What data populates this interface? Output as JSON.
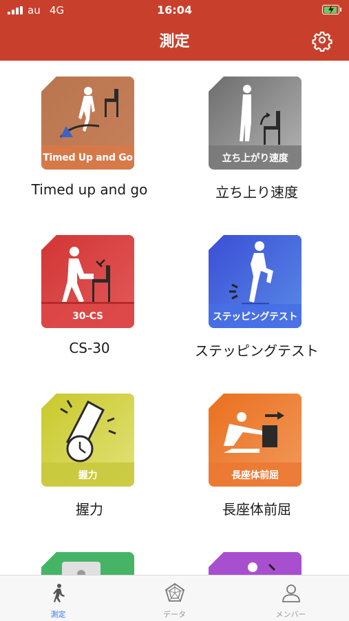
{
  "status_bar": {
    "carrier": "au",
    "network": "4G",
    "time": "16:04"
  },
  "header": {
    "title": "測定",
    "settings_icon": "gear-icon"
  },
  "tests": [
    {
      "label": "Timed up and go",
      "badge": "Timed Up and Go",
      "color": "#b0623a"
    },
    {
      "label": "立ち上り速度",
      "badge": "立ち上がり速度",
      "color": "#7d7d7d"
    },
    {
      "label": "CS-30",
      "badge": "30-CS",
      "color": "#d63c3c"
    },
    {
      "label": "ステッピングテスト",
      "badge": "ステッピングテスト",
      "color": "#3d55d9"
    },
    {
      "label": "握力",
      "badge": "握力",
      "color": "#c4c430"
    },
    {
      "label": "長座体前屈",
      "badge": "長座体前屈",
      "color": "#e8782a"
    },
    {
      "label": "",
      "badge": "",
      "color": "#45b565"
    },
    {
      "label": "",
      "badge": "",
      "color": "#a84fd0"
    }
  ],
  "tab_bar": {
    "items": [
      {
        "label": "測定",
        "icon": "walking-person-icon",
        "active": true
      },
      {
        "label": "データ",
        "icon": "pentagon-chart-icon",
        "active": false
      },
      {
        "label": "メンバー",
        "icon": "person-icon",
        "active": false
      }
    ],
    "active_color": "#3478f6",
    "inactive_color": "#999999"
  },
  "colors": {
    "brand": "#c8402c"
  }
}
